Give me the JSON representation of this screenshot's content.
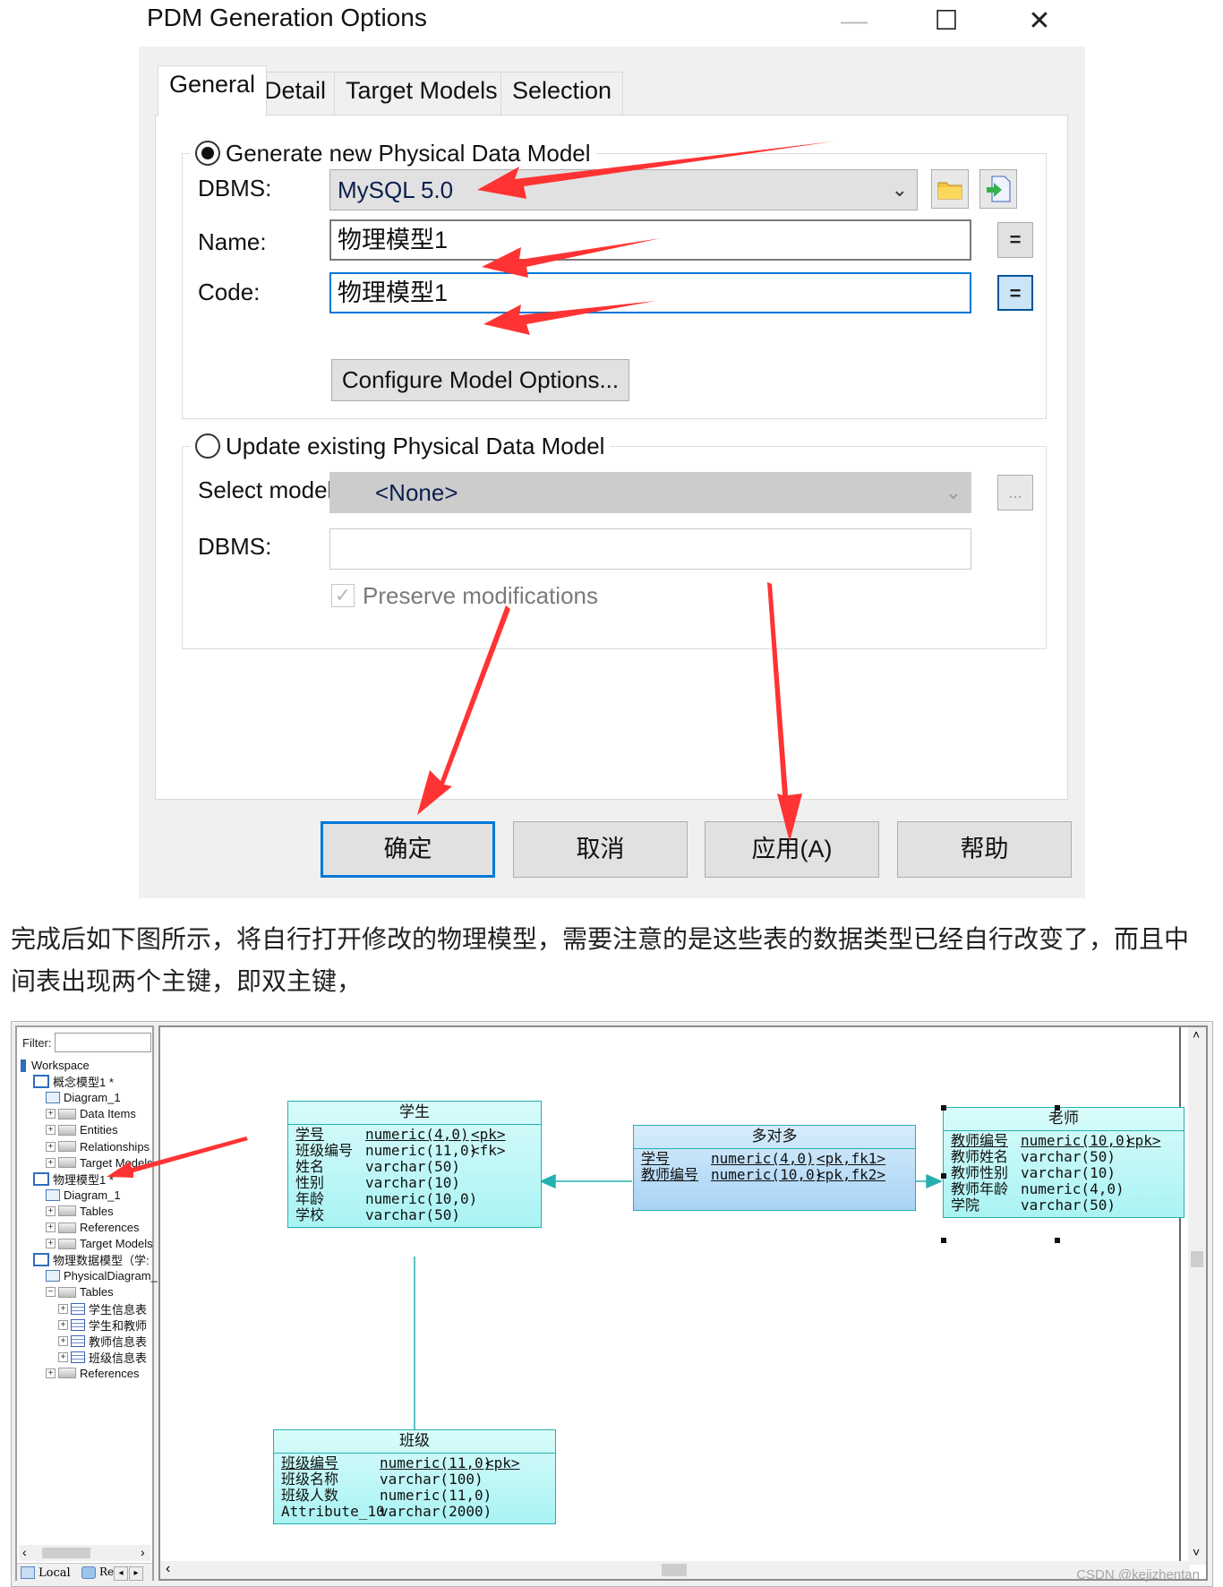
{
  "dialog": {
    "title": "PDM Generation Options",
    "window_controls": {
      "minimize": "—",
      "maximize": "☐",
      "close": "✕"
    },
    "tabs": [
      {
        "label": "General",
        "active": true
      },
      {
        "label": "Detail",
        "active": false
      },
      {
        "label": "Target Models",
        "active": false
      },
      {
        "label": "Selection",
        "active": false
      }
    ],
    "generate_group": {
      "radio_label": "Generate new Physical Data Model",
      "selected": true,
      "dbms_label": "DBMS:",
      "dbms_value": "MySQL 5.0",
      "name_label": "Name:",
      "name_value": "物理模型1",
      "code_label": "Code:",
      "code_value": "物理模型1",
      "equal_button": "=",
      "configure_button": "Configure Model Options..."
    },
    "update_group": {
      "radio_label": "Update existing Physical Data Model",
      "selected": false,
      "select_model_label": "Select model:",
      "select_model_value": "<None>",
      "ellipsis_button": "...",
      "dbms_label": "DBMS:",
      "dbms_value": "",
      "preserve_label": "Preserve modifications",
      "preserve_checked": true
    },
    "buttons": {
      "ok": "确定",
      "cancel": "取消",
      "apply": "应用(A)",
      "help": "帮助"
    }
  },
  "paragraph": "完成后如下图所示，将自行打开修改的物理模型，需要注意的是这些表的数据类型已经自行改变了，而且中间表出现两个主键，即双主键，",
  "browser": {
    "filter_label": "Filter:",
    "tree": [
      {
        "label": "Workspace",
        "level": 0,
        "icon": "workspace-icon"
      },
      {
        "label": "概念模型1 *",
        "level": 1,
        "icon": "conceptual-model-icon"
      },
      {
        "label": "Diagram_1",
        "level": 2,
        "icon": "diagram-icon"
      },
      {
        "label": "Data Items",
        "level": 2,
        "icon": "folder-icon",
        "expander": "+"
      },
      {
        "label": "Entities",
        "level": 2,
        "icon": "folder-icon",
        "expander": "+"
      },
      {
        "label": "Relationships",
        "level": 2,
        "icon": "folder-icon",
        "expander": "+"
      },
      {
        "label": "Target Models",
        "level": 2,
        "icon": "folder-icon",
        "expander": "+"
      },
      {
        "label": "物理模型1 *",
        "level": 1,
        "icon": "physical-model-icon"
      },
      {
        "label": "Diagram_1",
        "level": 2,
        "icon": "diagram-icon"
      },
      {
        "label": "Tables",
        "level": 2,
        "icon": "folder-icon",
        "expander": "+"
      },
      {
        "label": "References",
        "level": 2,
        "icon": "folder-icon",
        "expander": "+"
      },
      {
        "label": "Target Models",
        "level": 2,
        "icon": "folder-icon",
        "expander": "+"
      },
      {
        "label": "物理数据模型（学:",
        "level": 1,
        "icon": "physical-model-icon"
      },
      {
        "label": "PhysicalDiagram_",
        "level": 2,
        "icon": "diagram-icon"
      },
      {
        "label": "Tables",
        "level": 2,
        "icon": "folder-icon",
        "expander": "−"
      },
      {
        "label": "学生信息表",
        "level": 3,
        "icon": "table-icon",
        "expander": "+"
      },
      {
        "label": "学生和教师",
        "level": 3,
        "icon": "table-icon",
        "expander": "+"
      },
      {
        "label": "教师信息表",
        "level": 3,
        "icon": "table-icon",
        "expander": "+"
      },
      {
        "label": "班级信息表",
        "level": 3,
        "icon": "table-icon",
        "expander": "+"
      },
      {
        "label": "References",
        "level": 2,
        "icon": "folder-icon",
        "expander": "+"
      }
    ],
    "bottom_tabs": {
      "local": "Local",
      "repository": "Re"
    }
  },
  "diagram": {
    "entities": [
      {
        "id": "student",
        "title": "学生",
        "rows": [
          {
            "name": "学号",
            "type": "numeric(4,0)",
            "key": "<pk>",
            "underline": true
          },
          {
            "name": "班级编号",
            "type": "numeric(11,0)",
            "key": "<fk>",
            "underline": false
          },
          {
            "name": "姓名",
            "type": "varchar(50)",
            "key": "",
            "underline": false
          },
          {
            "name": "性别",
            "type": "varchar(10)",
            "key": "",
            "underline": false
          },
          {
            "name": "年龄",
            "type": "numeric(10,0)",
            "key": "",
            "underline": false
          },
          {
            "name": "学校",
            "type": "varchar(50)",
            "key": "",
            "underline": false
          }
        ]
      },
      {
        "id": "many-to-many",
        "title": "多对多",
        "rows": [
          {
            "name": "学号",
            "type": "numeric(4,0)",
            "key": "<pk,fk1>",
            "underline": true
          },
          {
            "name": "教师编号",
            "type": "numeric(10,0)",
            "key": "<pk,fk2>",
            "underline": true
          }
        ]
      },
      {
        "id": "teacher",
        "title": "老师",
        "rows": [
          {
            "name": "教师编号",
            "type": "numeric(10,0)",
            "key": "<pk>",
            "underline": true
          },
          {
            "name": "教师姓名",
            "type": "varchar(50)",
            "key": "",
            "underline": false
          },
          {
            "name": "教师性别",
            "type": "varchar(10)",
            "key": "",
            "underline": false
          },
          {
            "name": "教师年龄",
            "type": "numeric(4,0)",
            "key": "",
            "underline": false
          },
          {
            "name": "学院",
            "type": "varchar(50)",
            "key": "",
            "underline": false
          }
        ]
      },
      {
        "id": "class",
        "title": "班级",
        "rows": [
          {
            "name": "班级编号",
            "type": "numeric(11,0)",
            "key": "<pk>",
            "underline": true
          },
          {
            "name": "班级名称",
            "type": "varchar(100)",
            "key": "",
            "underline": false
          },
          {
            "name": "班级人数",
            "type": "numeric(11,0)",
            "key": "",
            "underline": false
          },
          {
            "name": "Attribute_10",
            "type": "varchar(2000)",
            "key": "",
            "underline": false
          }
        ]
      }
    ]
  },
  "watermark": "CSDN @kejizhentan",
  "colors": {
    "annotation_arrow": "#ff3333",
    "entity_border": "#25b0b0",
    "focus_blue": "#0078d7"
  }
}
